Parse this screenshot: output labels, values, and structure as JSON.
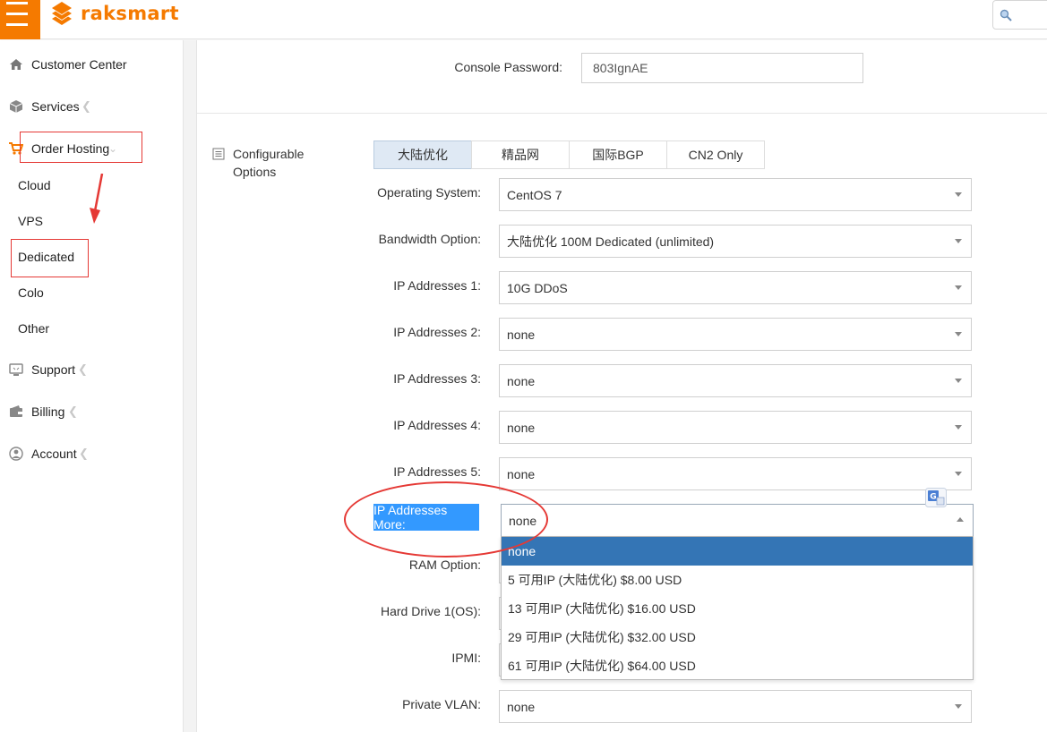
{
  "header": {
    "logo_text": "raksmart",
    "brand_color": "#f57a00",
    "menu_icon": "hamburger-icon",
    "search_icon": "search-icon"
  },
  "sidebar": {
    "customer_center": "Customer Center",
    "services": "Services",
    "order_hosting": "Order Hosting",
    "sub_items": [
      "Cloud",
      "VPS",
      "Dedicated",
      "Colo",
      "Other"
    ],
    "support": "Support",
    "billing": "Billing",
    "account": "Account"
  },
  "console": {
    "label": "Console Password:",
    "value": "803IgnAE"
  },
  "config": {
    "title": "Configurable Options",
    "tabs": [
      "大陆优化",
      "精品网",
      "国际BGP",
      "CN2 Only"
    ],
    "active_tab": "大陆优化",
    "rows": [
      {
        "label": "Operating System:",
        "value": "CentOS 7"
      },
      {
        "label": "Bandwidth Option:",
        "value": "大陆优化 100M Dedicated (unlimited)"
      },
      {
        "label": "IP Addresses 1:",
        "value": "10G DDoS"
      },
      {
        "label": "IP Addresses 2:",
        "value": "none"
      },
      {
        "label": "IP Addresses 3:",
        "value": "none"
      },
      {
        "label": "IP Addresses 4:",
        "value": "none"
      },
      {
        "label": "IP Addresses 5:",
        "value": "none"
      }
    ],
    "more": {
      "label": "IP Addresses More:",
      "value": "none"
    },
    "hidden_rows": [
      {
        "label": "RAM Option:"
      },
      {
        "label": "Hard Drive 1(OS):"
      },
      {
        "label": "IPMI:"
      }
    ],
    "private_vlan": {
      "label": "Private VLAN:",
      "value": "none"
    },
    "dropdown_options": [
      "none",
      "5 可用IP (大陆优化) $8.00 USD",
      "13 可用IP (大陆优化) $16.00 USD",
      "29 可用IP (大陆优化) $32.00 USD",
      "61 可用IP (大陆优化) $64.00 USD"
    ],
    "selected_option": "none"
  },
  "colors": {
    "accent": "#f57a00",
    "annotation_red": "#e53935",
    "selection_blue": "#3475b5",
    "highlight_blue": "#3399ff"
  }
}
